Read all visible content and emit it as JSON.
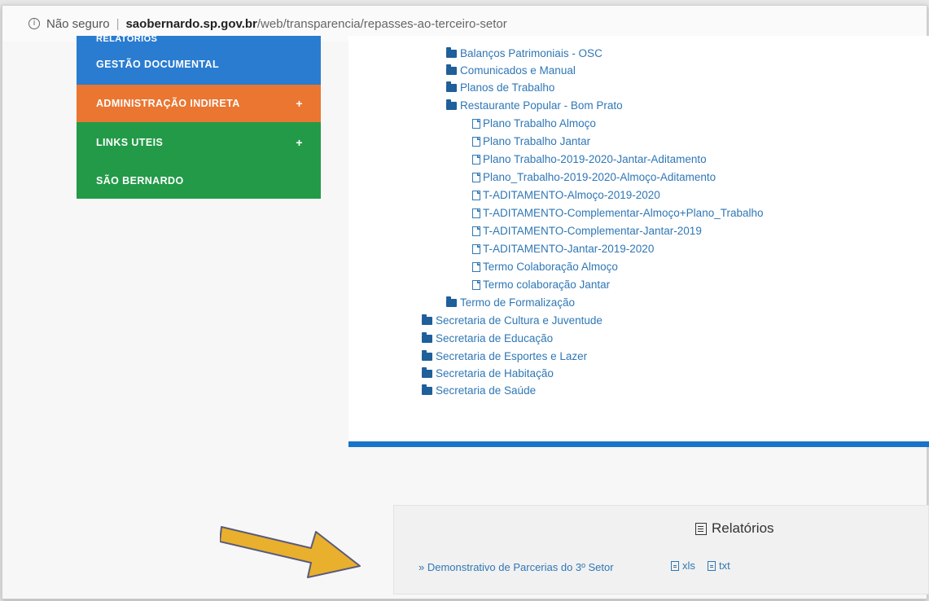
{
  "addressbar": {
    "security_label": "Não seguro",
    "host": "saobernardo.sp.gov.br",
    "path": "/web/transparencia/repasses-ao-terceiro-setor"
  },
  "sidebar": {
    "items": [
      {
        "label": "RELATÓRIOS",
        "color": "#2a7cd0"
      },
      {
        "label": "GESTÃO DOCUMENTAL",
        "color": "#2a7cd0"
      },
      {
        "label": "ADMINISTRAÇÃO INDIRETA",
        "color": "#ea7631",
        "expand": "+"
      },
      {
        "label": "LINKS UTEIS",
        "color": "#229a48",
        "expand": "+"
      },
      {
        "label": "SÃO BERNARDO",
        "color": "#229a48"
      }
    ]
  },
  "tree": {
    "items": [
      {
        "label": "Balanços Patrimoniais - OSC",
        "type": "folder"
      },
      {
        "label": "Comunicados e Manual",
        "type": "folder"
      },
      {
        "label": "Planos de Trabalho",
        "type": "folder"
      },
      {
        "label": "Restaurante Popular - Bom Prato",
        "type": "folder"
      },
      {
        "label": "Plano Trabalho Almoço",
        "type": "file"
      },
      {
        "label": "Plano Trabalho Jantar",
        "type": "file"
      },
      {
        "label": "Plano Trabalho-2019-2020-Jantar-Aditamento",
        "type": "file"
      },
      {
        "label": "Plano_Trabalho-2019-2020-Almoço-Aditamento",
        "type": "file"
      },
      {
        "label": "T-ADITAMENTO-Almoço-2019-2020",
        "type": "file"
      },
      {
        "label": "T-ADITAMENTO-Complementar-Almoço+Plano_Trabalho",
        "type": "file"
      },
      {
        "label": "T-ADITAMENTO-Complementar-Jantar-2019",
        "type": "file"
      },
      {
        "label": "T-ADITAMENTO-Jantar-2019-2020",
        "type": "file"
      },
      {
        "label": "Termo Colaboração Almoço",
        "type": "file"
      },
      {
        "label": "Termo colaboração Jantar",
        "type": "file"
      },
      {
        "label": "Termo de Formalização",
        "type": "folder"
      },
      {
        "label": "Secretaria de Cultura e Juventude",
        "type": "folder"
      },
      {
        "label": "Secretaria de Educação",
        "type": "folder"
      },
      {
        "label": "Secretaria de Esportes e Lazer",
        "type": "folder"
      },
      {
        "label": "Secretaria de Habitação",
        "type": "folder"
      },
      {
        "label": "Secretaria de Saúde",
        "type": "folder"
      }
    ]
  },
  "reports": {
    "title": "Relatórios",
    "link": "» Demonstrativo de Parcerias do 3º Setor",
    "xls": "xls",
    "txt": "txt"
  },
  "colors": {
    "link": "#2f77b5",
    "rule": "#1973c9",
    "arrow": "#e9b02e"
  }
}
